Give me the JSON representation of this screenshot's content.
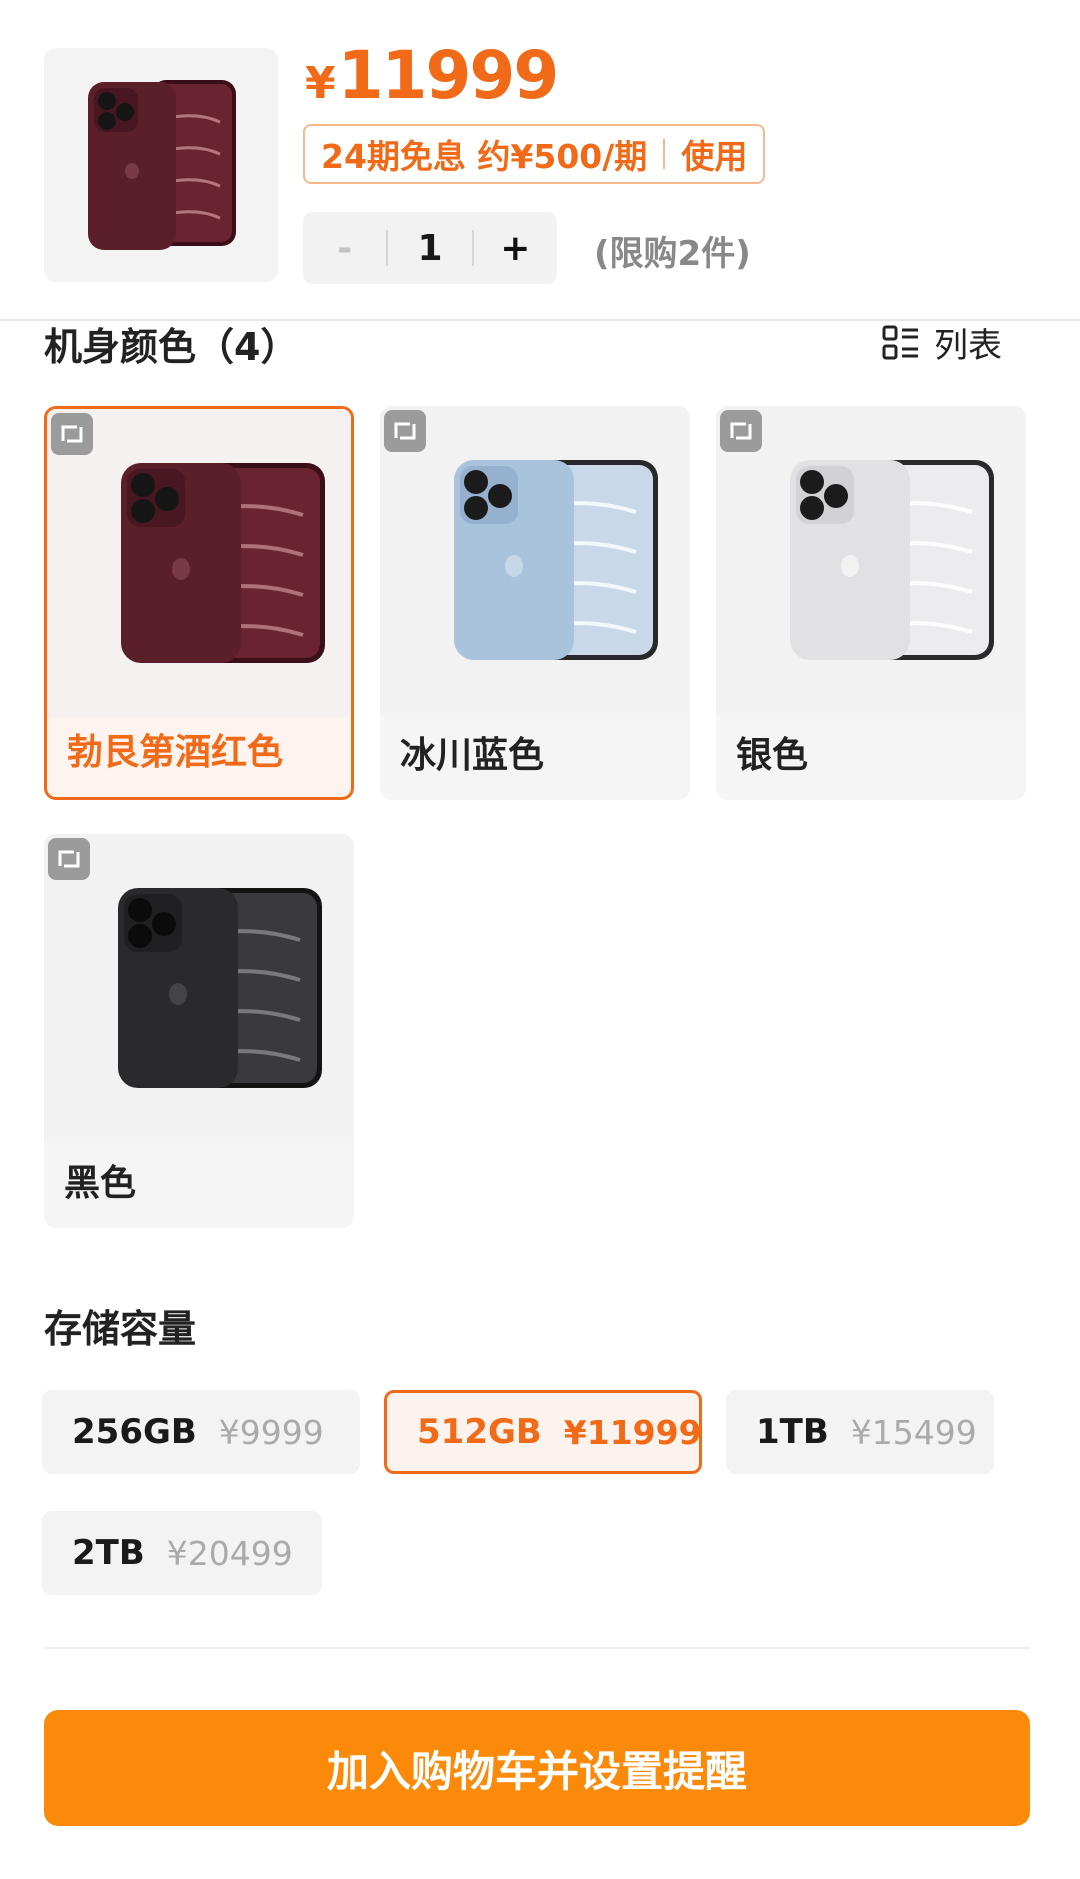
{
  "product": {
    "price_currency": "¥",
    "price_value": "11999",
    "installment_text": "24期免息 约¥500/期",
    "installment_action": "使用",
    "quantity": "1",
    "minus_label": "-",
    "plus_label": "+",
    "limit_text": "(限购2件)"
  },
  "color_section": {
    "title": "机身颜色（4）",
    "list_label": "列表",
    "options": [
      {
        "label": "勃艮第酒红色",
        "selected": true,
        "body_color": "#5b1f2a"
      },
      {
        "label": "冰川蓝色",
        "selected": false,
        "body_color": "#a9c3dd"
      },
      {
        "label": "银色",
        "selected": false,
        "body_color": "#e4e4e6"
      },
      {
        "label": "黑色",
        "selected": false,
        "body_color": "#2a2a2c"
      }
    ]
  },
  "storage_section": {
    "title": "存储容量",
    "options": [
      {
        "capacity": "256GB",
        "price": "¥9999",
        "selected": false
      },
      {
        "capacity": "512GB",
        "price": "¥11999",
        "selected": true
      },
      {
        "capacity": "1TB",
        "price": "¥15499",
        "selected": false
      },
      {
        "capacity": "2TB",
        "price": "¥20499",
        "selected": false
      }
    ]
  },
  "cta_label": "加入购物车并设置提醒",
  "colors": {
    "accent": "#f06a18",
    "cta": "#fb8a0b"
  }
}
